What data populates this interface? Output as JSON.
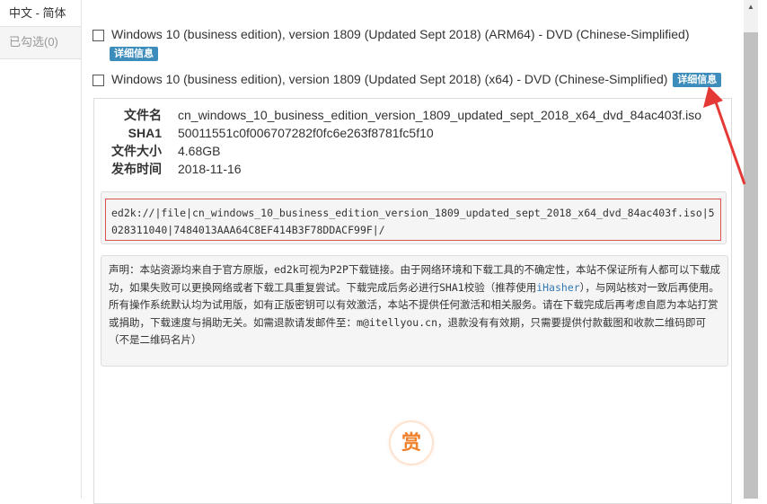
{
  "sidebar": {
    "tabs": [
      {
        "label": "中文 - 简体"
      },
      {
        "label": "已勾选(0)"
      }
    ]
  },
  "items": [
    {
      "label": "Windows 10 (business edition), version 1809 (Updated Sept 2018) (ARM64) - DVD (Chinese-Simplified)",
      "badge": "详细信息"
    },
    {
      "label": "Windows 10 (business edition), version 1809 (Updated Sept 2018) (x64) - DVD (Chinese-Simplified)",
      "badge": "详细信息"
    }
  ],
  "details": {
    "filename_label": "文件名",
    "filename": "cn_windows_10_business_edition_version_1809_updated_sept_2018_x64_dvd_84ac403f.iso",
    "sha1_label": "SHA1",
    "sha1": "50011551c0f006707282f0fc6e263f8781fc5f10",
    "size_label": "文件大小",
    "size": "4.68GB",
    "date_label": "发布时间",
    "date": "2018-11-16",
    "ed2k": "ed2k://|file|cn_windows_10_business_edition_version_1809_updated_sept_2018_x64_dvd_84ac403f.iso|5028311040|7484013AAA64C8EF414B3F78DDACF99F|/",
    "notice_part1": "声明：本站资源均来自于官方原版，ed2k可视为P2P下载链接。由于网络环境和下载工具的不确定性，本站不保证所有人都可以下载成功，如果失败可以更换网络或者下载工具重复尝试。下载完成后务必进行SHA1校验（推荐使用",
    "notice_link": "iHasher",
    "notice_part2": "），与网站核对一致后再使用。所有操作系统默认均为试用版，如有正版密钥可以有效激活，本站不提供任何激活和相关服务。请在下载完成后再考虑自愿为本站打赏或捐助，下载速度与捐助无关。如需退款请发邮件至：m@itellyou.cn，退款没有有效期，只需要提供付款截图和收款二维码即可（不是二维码名片）",
    "reward": "赏"
  },
  "colors": {
    "badge": "#3c8dbc",
    "highlight": "#d9534f",
    "arrow": "#e53935",
    "reward": "#f0802a"
  }
}
